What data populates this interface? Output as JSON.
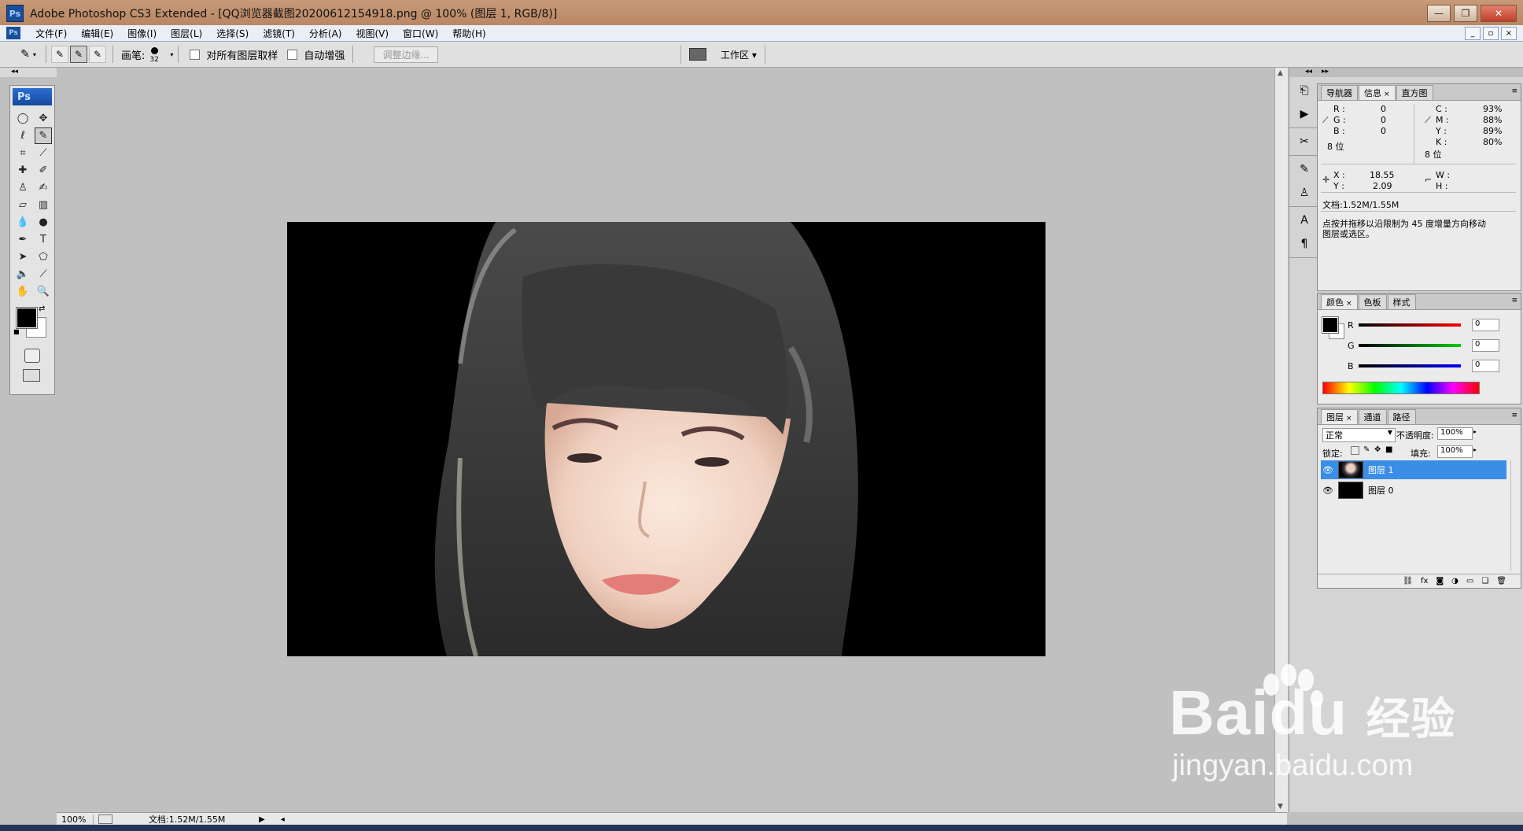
{
  "window": {
    "title": "Adobe Photoshop CS3 Extended - [QQ浏览器截图20200612154918.png @ 100% (图层 1, RGB/8)]",
    "app_icon_text": "Ps",
    "buttons": {
      "minimize": "—",
      "restore": "❐",
      "close": "✕"
    }
  },
  "menu": {
    "items": [
      "文件(F)",
      "编辑(E)",
      "图像(I)",
      "图层(L)",
      "选择(S)",
      "滤镜(T)",
      "分析(A)",
      "视图(V)",
      "窗口(W)",
      "帮助(H)"
    ],
    "doc_buttons": {
      "minimize": "_",
      "restore": "▫",
      "close": "×"
    }
  },
  "options": {
    "brush_label": "画笔:",
    "brush_size": "32",
    "sample_all_layers": "对所有图层取样",
    "auto_enhance": "自动增强",
    "refine_edge": "调整边缘...",
    "workspace": "工作区 ▾"
  },
  "toolbox": {
    "logo": "Ps"
  },
  "status": {
    "zoom": "100%",
    "doc": "文档:1.52M/1.55M"
  },
  "info_panel": {
    "tabs": [
      "导航器",
      "信息",
      "直方图"
    ],
    "rgb": {
      "R": "0",
      "G": "0",
      "B": "0"
    },
    "cmyk": {
      "C": "93%",
      "M": "88%",
      "Y": "89%",
      "K": "80%"
    },
    "bit_left": "8 位",
    "bit_right": "8 位",
    "xy": {
      "X": "18.55",
      "Y": "2.09"
    },
    "wh": {
      "W": "",
      "H": ""
    },
    "doc": "文档:1.52M/1.55M",
    "hint_line1": "点按并拖移以沿限制为 45 度增量方向移动",
    "hint_line2": "图层或选区。"
  },
  "color_panel": {
    "tabs": [
      "颜色",
      "色板",
      "样式"
    ],
    "R": "0",
    "G": "0",
    "B": "0"
  },
  "layers_panel": {
    "tabs": [
      "图层",
      "通道",
      "路径"
    ],
    "blend_mode": "正常",
    "opacity_label": "不透明度:",
    "opacity": "100%",
    "lock_label": "锁定:",
    "fill_label": "填充:",
    "fill": "100%",
    "layers": [
      {
        "name": "图层 1",
        "selected": true
      },
      {
        "name": "图层 0",
        "selected": false
      }
    ]
  },
  "watermark": {
    "brand": "Baidu",
    "brand_cn": "经验",
    "url": "jingyan.baidu.com"
  },
  "colors": {
    "accent": "#3a8ee6",
    "titlebar": "#c0906c",
    "canvas_bg": "#c0c0c0"
  }
}
